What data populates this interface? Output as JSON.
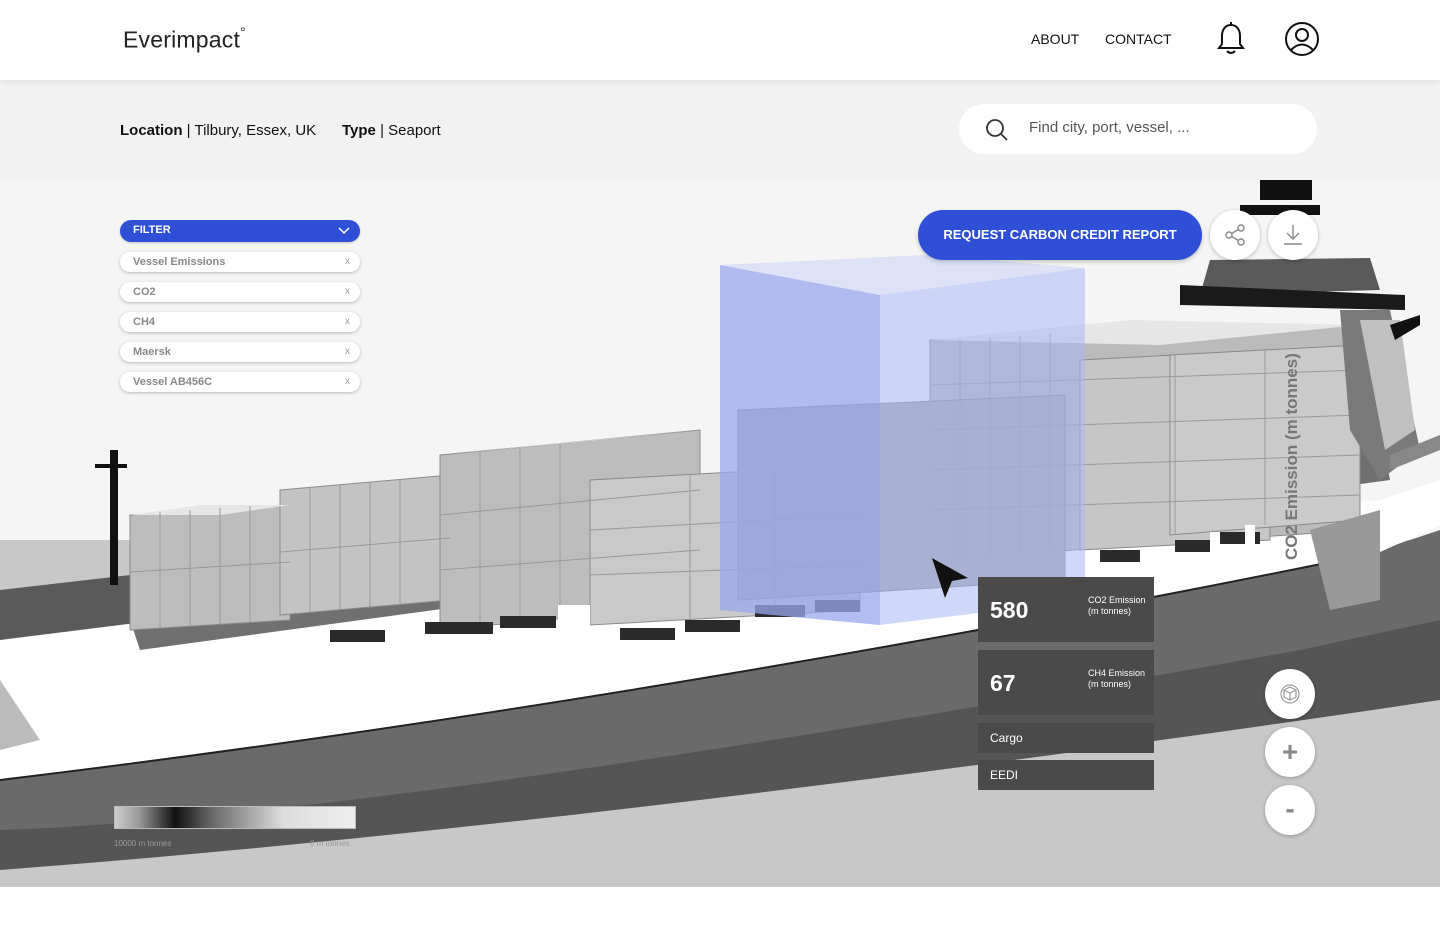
{
  "header": {
    "logo": "Everimpact",
    "logo_mark": "°",
    "nav": {
      "about": "ABOUT",
      "contact": "CONTACT"
    },
    "icons": {
      "notifications": "bell-icon",
      "account": "user-icon"
    }
  },
  "info": {
    "location_label": "Location",
    "location_value": "| Tilbury, Essex, UK",
    "type_label": "Type",
    "type_value": "| Seaport"
  },
  "search": {
    "placeholder": "Find city, port, vessel, ..."
  },
  "filter": {
    "title": "FILTER",
    "chips": [
      {
        "label": "Vessel Emissions",
        "remove": "x"
      },
      {
        "label": "CO2",
        "remove": "x"
      },
      {
        "label": "CH4",
        "remove": "x"
      },
      {
        "label": "Maersk",
        "remove": "x"
      },
      {
        "label": "Vessel AB456C",
        "remove": "x"
      }
    ]
  },
  "actions": {
    "request_report": "REQUEST CARBON CREDIT REPORT",
    "share_icon": "share-icon",
    "download_icon": "download-icon"
  },
  "stats": {
    "co2": {
      "value": "580",
      "caption": "CO2 Emission (m tonnes)"
    },
    "ch4": {
      "value": "67",
      "caption": "CH4 Emission (m tonnes)"
    },
    "cargo": "Cargo",
    "eedi": "EEDI"
  },
  "axis_label": "CO2 Emission (m tonnes)",
  "legend": {
    "min_label": "10000 m tonnes",
    "max_label": "0 m tonnes"
  },
  "controls": {
    "rotate": "rotate-3d-icon",
    "zoom_in": "+",
    "zoom_out": "-"
  },
  "colors": {
    "accent": "#2f4fd6",
    "panel": "#4a4a4a",
    "highlight": "#a9b8f5"
  }
}
